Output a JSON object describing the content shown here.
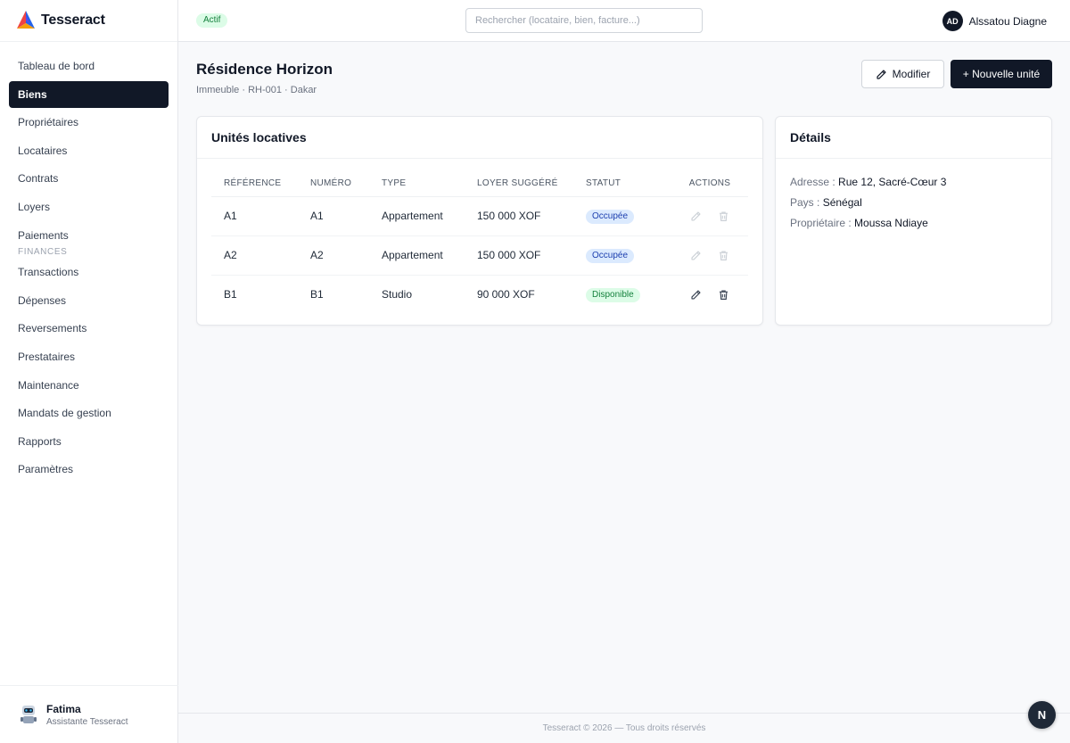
{
  "app": {
    "name": "Tesseract"
  },
  "sidebar": {
    "items": [
      {
        "label": "Tableau de bord"
      },
      {
        "label": "Biens",
        "active": true
      },
      {
        "label": "Propriétaires"
      },
      {
        "label": "Locataires"
      },
      {
        "label": "Contrats"
      },
      {
        "label": "Loyers"
      },
      {
        "label": "Paiements"
      }
    ],
    "section_finances": "FINANCES",
    "finance_items": [
      {
        "label": "Transactions"
      },
      {
        "label": "Dépenses"
      },
      {
        "label": "Reversements"
      },
      {
        "label": "Prestataires"
      },
      {
        "label": "Maintenance"
      },
      {
        "label": "Mandats de gestion"
      },
      {
        "label": "Rapports"
      },
      {
        "label": "Paramètres"
      }
    ],
    "assistant": {
      "name": "Fatima",
      "role": "Assistante Tesseract"
    }
  },
  "topbar": {
    "status": "Actif",
    "search_placeholder": "Rechercher (locataire, bien, facture...)",
    "user": {
      "initials": "AD",
      "name": "Alssatou Diagne"
    }
  },
  "page": {
    "title": "Résidence Horizon",
    "subtitle": "Immeuble · RH-001 · Dakar",
    "edit_label": "Modifier",
    "new_unit_label": "+ Nouvelle unité"
  },
  "units": {
    "title": "Unités locatives",
    "headers": [
      "RÉFÉRENCE",
      "NUMÉRO",
      "TYPE",
      "LOYER SUGGÉRÉ",
      "STATUT",
      "ACTIONS"
    ],
    "rows": [
      {
        "reference": "A1",
        "numero": "A1",
        "type": "Appartement",
        "loyer": "150 000 XOF",
        "statut": "Occupée",
        "actions_enabled": false
      },
      {
        "reference": "A2",
        "numero": "A2",
        "type": "Appartement",
        "loyer": "150 000 XOF",
        "statut": "Occupée",
        "actions_enabled": false
      },
      {
        "reference": "B1",
        "numero": "B1",
        "type": "Studio",
        "loyer": "90 000 XOF",
        "statut": "Disponible",
        "actions_enabled": true
      }
    ]
  },
  "details": {
    "title": "Détails",
    "address_label": "Adresse :",
    "address": "Rue 12, Sacré-Cœur 3",
    "country_label": "Pays :",
    "country": "Sénégal",
    "owner_label": "Propriétaire :",
    "owner": "Moussa Ndiaye"
  },
  "footer": {
    "text": "Tesseract © 2026 — Tous droits réservés"
  },
  "fab": {
    "label": "N"
  },
  "colors": {
    "primary": "#111827",
    "badge_occupied_bg": "#dbeafe",
    "badge_available_bg": "#dcfce7",
    "status_active_bg": "#dcfce7"
  }
}
